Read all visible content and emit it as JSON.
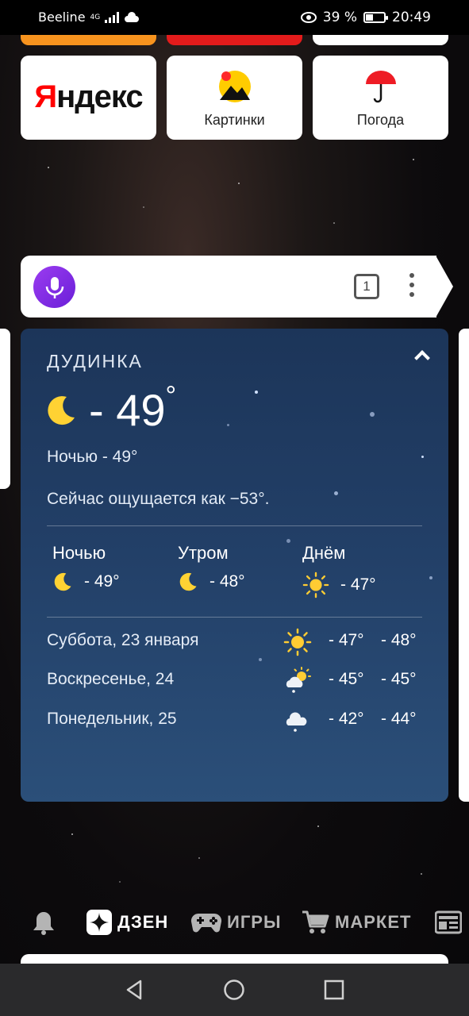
{
  "status_bar": {
    "carrier": "Beeline",
    "network": "4G",
    "battery": "39 %",
    "battery_level": 0.39,
    "time": "20:49"
  },
  "tiles": [
    {
      "label": "Яндекс",
      "logo": "yandex-logo"
    },
    {
      "label": "Картинки",
      "icon": "pictures-icon"
    },
    {
      "label": "Погода",
      "icon": "umbrella-icon"
    }
  ],
  "search": {
    "mic_icon": "microphone-icon",
    "tabs_count": "1",
    "menu_icon": "more-vertical-icon"
  },
  "weather": {
    "city": "ДУДИНКА",
    "current_icon": "moon-icon",
    "current_temp": "- 49",
    "degree_sign": "°",
    "night_line": "Ночью - 49°",
    "feels_like": "Сейчас ощущается как −53°.",
    "periods": [
      {
        "name": "Ночью",
        "temp": "- 49°",
        "icon": "moon-icon"
      },
      {
        "name": "Утром",
        "temp": "- 48°",
        "icon": "moon-icon"
      },
      {
        "name": "Днём",
        "temp": "- 47°",
        "icon": "sun-icon"
      }
    ],
    "forecast": [
      {
        "day": "Суббота, 23 января",
        "icon": "sun-icon",
        "high": "- 47°",
        "low": "- 48°"
      },
      {
        "day": "Воскресенье, 24",
        "icon": "partly-cloudy-snow-icon",
        "high": "- 45°",
        "low": "- 45°"
      },
      {
        "day": "Понедельник, 25",
        "icon": "cloud-snow-icon",
        "high": "- 42°",
        "low": "- 44°"
      }
    ]
  },
  "bottom_nav": {
    "items": [
      {
        "label": "",
        "icon": "bell-icon"
      },
      {
        "label": "ДЗЕН",
        "icon": "zen-icon"
      },
      {
        "label": "ИГРЫ",
        "icon": "gamepad-icon"
      },
      {
        "label": "МАРКЕТ",
        "icon": "cart-icon"
      },
      {
        "label": "",
        "icon": "news-icon"
      }
    ]
  },
  "colors": {
    "accent_orange": "#f7931e",
    "accent_red": "#e31b1b",
    "mic_purple": "#8a2be2",
    "weather_bg": "#223f67",
    "sun_yellow": "#ffcc33"
  }
}
